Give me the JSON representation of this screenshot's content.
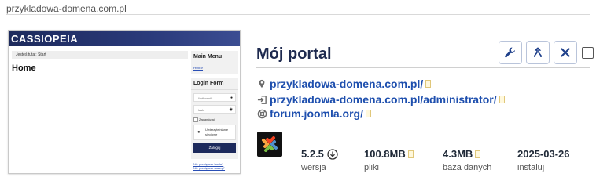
{
  "header": {
    "domain": "przykladowa-domena.com.pl"
  },
  "thumbnail": {
    "brand": "CASSIOPEIA",
    "breadcrumb": "Jesteś tutaj:   Start",
    "page_heading": "Home",
    "main_menu": {
      "title": "Main Menu",
      "link": "Home"
    },
    "login_form": {
      "title": "Login Form",
      "username_placeholder": "Użytkownik",
      "password_placeholder": "Hasło",
      "remember_label": "Zapamiętaj",
      "passkey_label": "Uwierzytelnianie sieciowe",
      "login_button": "Zaloguj",
      "forgot_password": "Nie pamiętasz hasła?",
      "forgot_username": "Nie pamiętasz nazwy?"
    }
  },
  "site": {
    "title": "Mój portal",
    "links": {
      "frontend": "przykladowa-domena.com.pl/",
      "admin": "przykladowa-domena.com.pl/administrator/",
      "forum": "forum.joomla.org/"
    },
    "icons": {
      "frontend": "location-pin-icon",
      "admin": "login-arrow-icon",
      "forum": "support-lifebuoy-icon"
    },
    "actions": [
      "wrench-icon",
      "merge-arrows-icon",
      "close-icon"
    ],
    "stats": {
      "version": {
        "value": "5.2.5",
        "label": "wersja"
      },
      "files": {
        "value": "100.8MB",
        "label": "pliki"
      },
      "database": {
        "value": "4.3MB",
        "label": "baza danych"
      },
      "installed": {
        "value": "2025-03-26",
        "label": "instaluj"
      }
    }
  },
  "colors": {
    "accent": "#1e4fae",
    "title": "#1e2a4f",
    "brand_header": "#1d2a5c"
  }
}
